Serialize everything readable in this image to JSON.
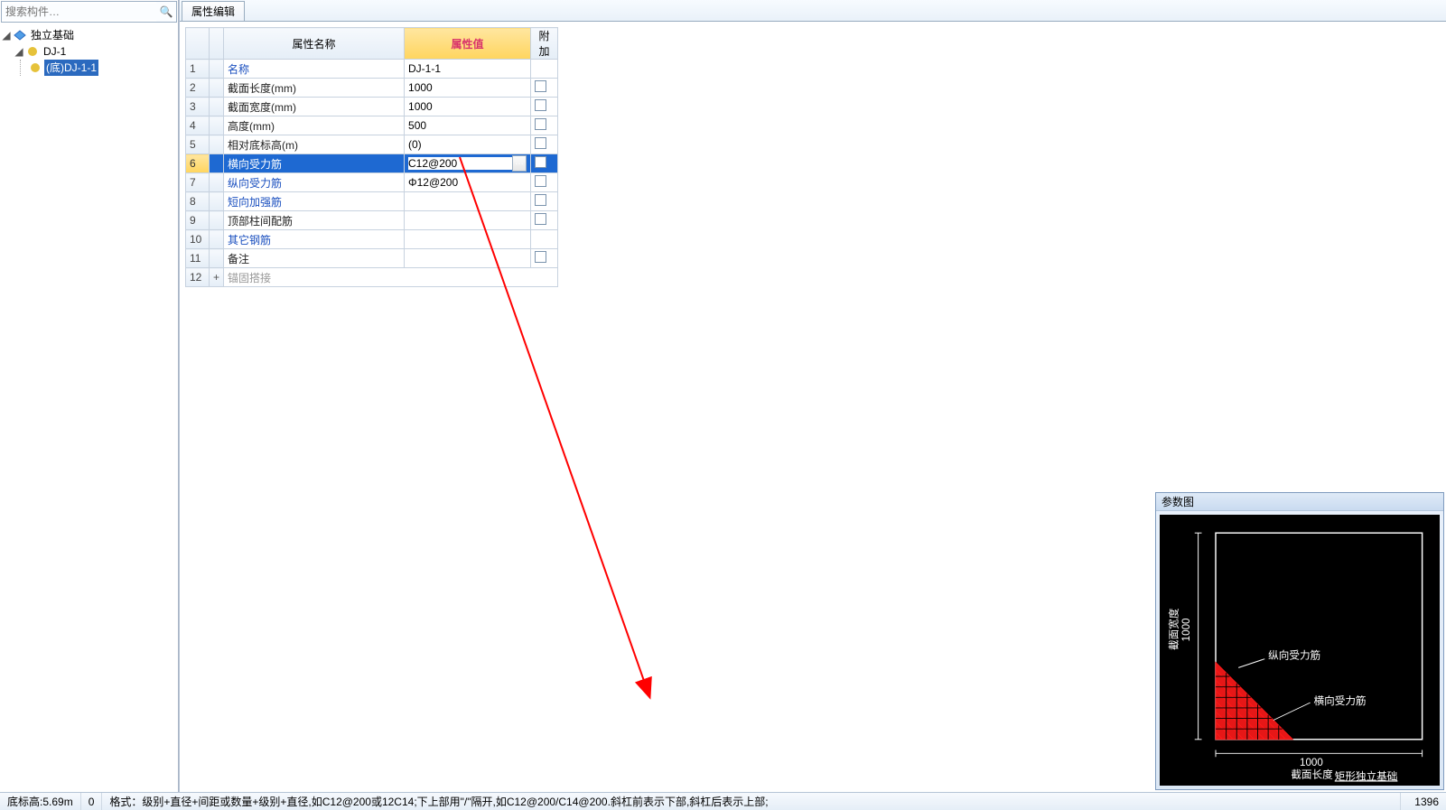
{
  "sidebar": {
    "search_placeholder": "搜索构件…",
    "root": {
      "label": "独立基础"
    },
    "child": {
      "label": "DJ-1"
    },
    "leaf": {
      "label": "(底)DJ-1-1"
    }
  },
  "panel": {
    "tab": "属性编辑",
    "col_name": "属性名称",
    "col_value": "属性值",
    "col_add": "附加"
  },
  "rows": [
    {
      "n": "1",
      "name": "名称",
      "link": true,
      "value": "DJ-1-1",
      "chk": false
    },
    {
      "n": "2",
      "name": "截面长度(mm)",
      "link": false,
      "value": "1000",
      "chk": true
    },
    {
      "n": "3",
      "name": "截面宽度(mm)",
      "link": false,
      "value": "1000",
      "chk": true
    },
    {
      "n": "4",
      "name": "高度(mm)",
      "link": false,
      "value": "500",
      "chk": true
    },
    {
      "n": "5",
      "name": "相对底标高(m)",
      "link": false,
      "value": "(0)",
      "chk": true
    },
    {
      "n": "6",
      "name": "横向受力筋",
      "link": true,
      "value": "C12@200",
      "chk": true,
      "editing": true
    },
    {
      "n": "7",
      "name": "纵向受力筋",
      "link": true,
      "value": "Φ12@200",
      "chk": true
    },
    {
      "n": "8",
      "name": "短向加强筋",
      "link": true,
      "value": "",
      "chk": true
    },
    {
      "n": "9",
      "name": "顶部柱间配筋",
      "link": false,
      "value": "",
      "chk": true
    },
    {
      "n": "10",
      "name": "其它钢筋",
      "link": true,
      "value": "",
      "chk": false
    },
    {
      "n": "11",
      "name": "备注",
      "link": false,
      "value": "",
      "chk": true
    },
    {
      "n": "12",
      "name": "锚固搭接",
      "link": false,
      "value": "",
      "chk": false,
      "collapsed": true
    }
  ],
  "diagram": {
    "title": "参数图",
    "label_vert_rebar": "纵向受力筋",
    "label_horz_rebar": "横向受力筋",
    "label_len_axis": "截面长度",
    "label_wid_axis": "截面宽度",
    "dim_len": "1000",
    "dim_wid": "1000",
    "caption": "矩形独立基础"
  },
  "status": {
    "left1": "底标高:5.69m",
    "left2": "0",
    "hint": "格式：级别+直径+间距或数量+级别+直径,如C12@200或12C14;下上部用\"/\"隔开,如C12@200/C14@200.斜杠前表示下部,斜杠后表示上部;",
    "right_num": "1396"
  }
}
